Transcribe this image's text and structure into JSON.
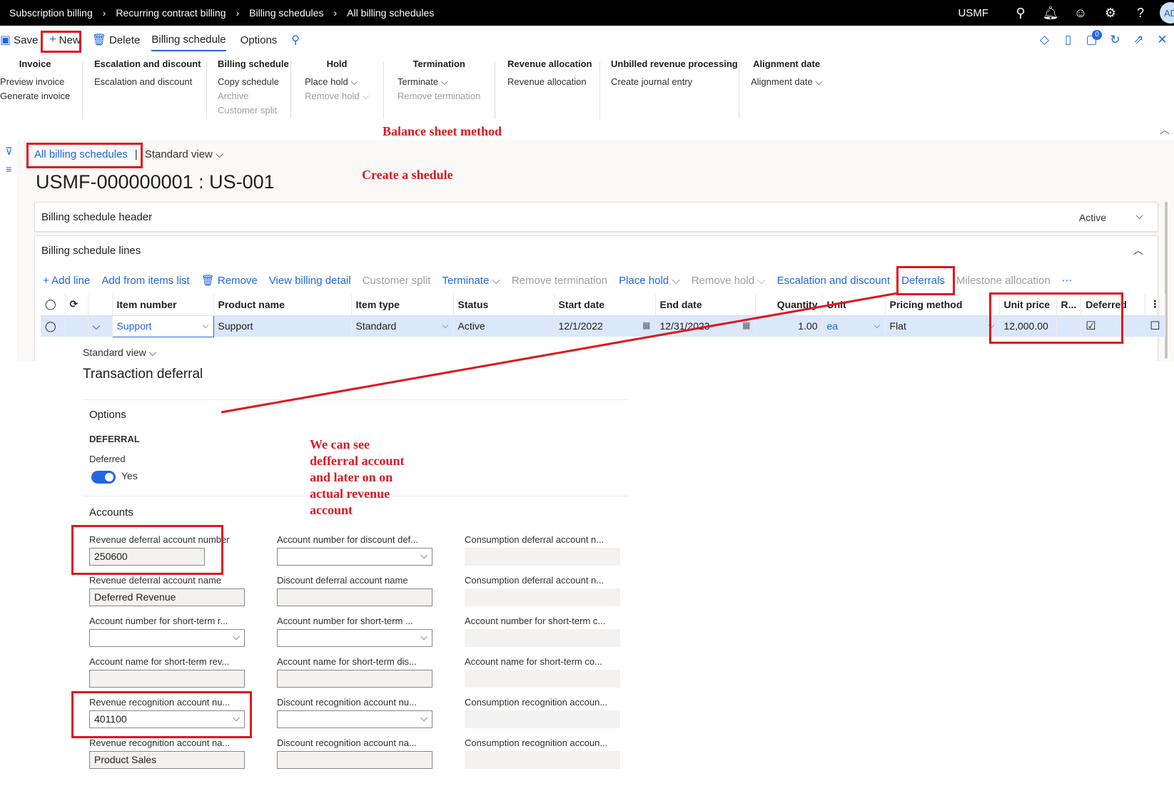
{
  "breadcrumb": [
    "Subscription billing",
    "Recurring contract billing",
    "Billing schedules",
    "All billing schedules"
  ],
  "company": "USMF",
  "avatar_initials": "AD",
  "actions": {
    "save": "Save",
    "new": "New",
    "delete": "Delete",
    "tab_billing_schedule": "Billing schedule",
    "tab_options": "Options",
    "badge_count": "0"
  },
  "ribbon": {
    "invoice": {
      "title": "Invoice",
      "items": [
        "Preview invoice",
        "Generate invoice"
      ]
    },
    "escalation": {
      "title": "Escalation and discount",
      "items": [
        "Escalation and discount"
      ]
    },
    "billing_schedule": {
      "title": "Billing schedule",
      "items": [
        "Copy schedule",
        "Archive",
        "Customer split"
      ]
    },
    "hold": {
      "title": "Hold",
      "items": [
        "Place hold",
        "Remove hold"
      ]
    },
    "termination": {
      "title": "Termination",
      "items": [
        "Terminate",
        "Remove termination"
      ]
    },
    "revenue_allocation": {
      "title": "Revenue allocation",
      "items": [
        "Revenue allocation"
      ]
    },
    "unbilled": {
      "title": "Unbilled revenue processing",
      "items": [
        "Create journal entry"
      ]
    },
    "alignment": {
      "title": "Alignment date",
      "items": [
        "Alignment date"
      ]
    }
  },
  "view": {
    "link": "All billing schedules",
    "standard_view": "Standard view"
  },
  "page_title": "USMF-000000001 : US-001",
  "header_panel": {
    "title": "Billing schedule header",
    "status": "Active"
  },
  "lines_panel": {
    "title": "Billing schedule lines"
  },
  "grid_actions": {
    "add_line": "Add line",
    "add_from_items": "Add from items list",
    "remove": "Remove",
    "view_billing_detail": "View billing detail",
    "customer_split": "Customer split",
    "terminate": "Terminate",
    "remove_termination": "Remove termination",
    "place_hold": "Place hold",
    "remove_hold": "Remove hold",
    "escalation": "Escalation and discount",
    "deferrals": "Deferrals",
    "milestone": "Milestone allocation",
    "more": "⋯"
  },
  "grid": {
    "columns": [
      "Item number",
      "Product name",
      "Item type",
      "Status",
      "Start date",
      "End date",
      "Quantity",
      "Unit",
      "Pricing method",
      "Unit price",
      "R...",
      "Deferred"
    ],
    "row": {
      "item_number": "Support",
      "product_name": "Support",
      "item_type": "Standard",
      "status": "Active",
      "start_date": "12/1/2022",
      "end_date": "12/31/2023",
      "quantity": "1.00",
      "unit": "ea",
      "pricing_method": "Flat",
      "unit_price": "12,000.00"
    }
  },
  "detail": {
    "standard_view": "Standard view",
    "section_title": "Transaction deferral",
    "options_header": "Options",
    "deferral_header": "DEFERRAL",
    "deferred_label": "Deferred",
    "deferred_value": "Yes",
    "accounts_header": "Accounts",
    "fields": {
      "rev_def_num_label": "Revenue deferral account number",
      "rev_def_num_value": "250600",
      "rev_def_name_label": "Revenue deferral account name",
      "rev_def_name_value": "Deferred Revenue",
      "st_r_num_label": "Account number for short-term r...",
      "st_r_name_label": "Account name for short-term rev...",
      "rev_rec_num_label": "Revenue recognition account nu...",
      "rev_rec_num_value": "401100",
      "rev_rec_name_label": "Revenue recognition account na...",
      "rev_rec_name_value": "Product Sales",
      "disc_def_num_label": "Account number for discount def...",
      "disc_def_name_label": "Discount deferral account name",
      "st_d_num_label": "Account number for short-term ...",
      "st_d_name_label": "Account name for short-term dis...",
      "disc_rec_num_label": "Discount recognition account nu...",
      "disc_rec_name_label": "Discount recognition account na...",
      "cons_def_num_label": "Consumption deferral account n...",
      "cons_def_name_label": "Consumption deferral account n...",
      "st_c_num_label": "Account number for short-term c...",
      "st_c_name_label": "Account name for short-term co...",
      "cons_rec_num_label": "Consumption recognition accoun...",
      "cons_rec_name_label": "Consumption recognition accoun..."
    }
  },
  "annotations": {
    "balance_sheet": "Balance sheet method",
    "create_schedule": "Create a shedule",
    "note_lines": [
      "We can see",
      "defferral account",
      "and later on on",
      "actual revenue",
      "account"
    ]
  },
  "colors": {
    "accent": "#2266e3",
    "annotation_red": "#e0161f",
    "selected_row": "#dbe7fb"
  }
}
